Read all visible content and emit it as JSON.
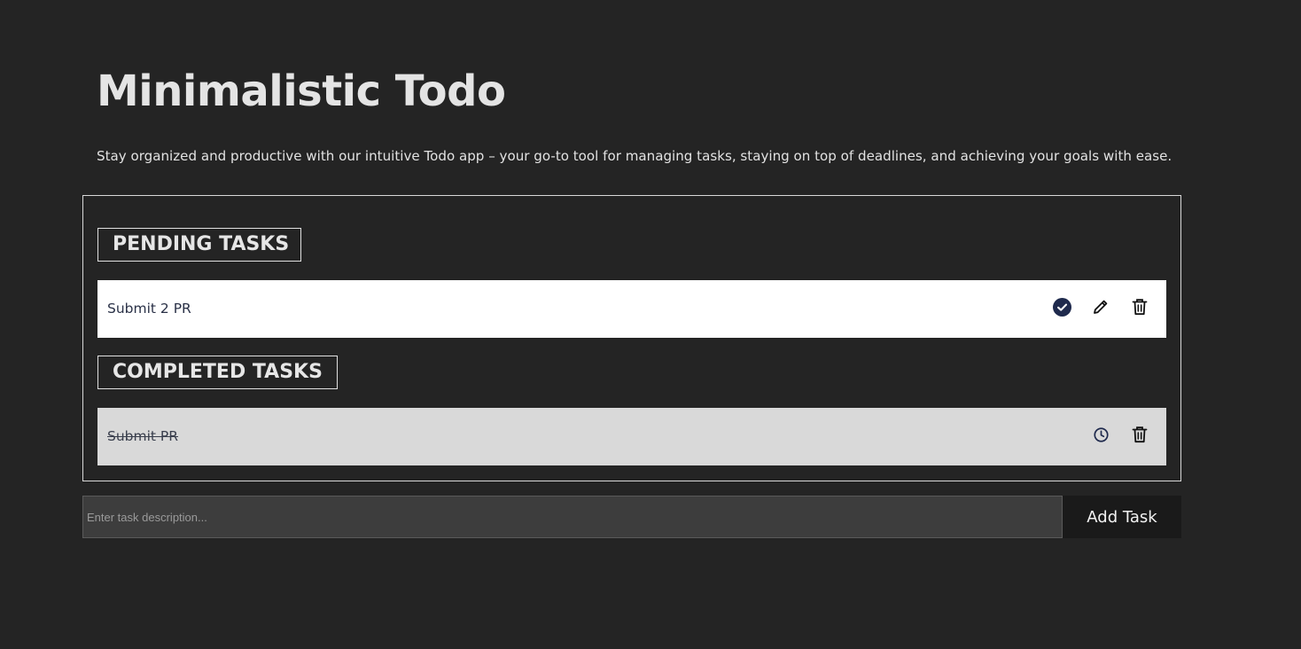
{
  "header": {
    "title": "Minimalistic Todo",
    "subtitle": "Stay organized and productive with our intuitive Todo app – your go-to tool for managing tasks, staying on top of deadlines, and achieving your goals with ease."
  },
  "pending": {
    "heading": "PENDING TASKS",
    "tasks": [
      {
        "text": "Submit 2 PR",
        "actions": [
          "check-circle-icon",
          "pencil-icon",
          "trash-icon"
        ]
      }
    ]
  },
  "completed": {
    "heading": "COMPLETED TASKS",
    "tasks": [
      {
        "text": "Submit PR",
        "actions": [
          "clock-icon",
          "trash-icon"
        ]
      }
    ]
  },
  "composer": {
    "placeholder": "Enter task description...",
    "value": "",
    "add_label": "Add Task"
  },
  "colors": {
    "background": "#242424",
    "pending_row": "#ffffff",
    "completed_row": "#d9d9d9",
    "accent": "#1f2a4d",
    "button_bg": "#1a1a1a"
  }
}
